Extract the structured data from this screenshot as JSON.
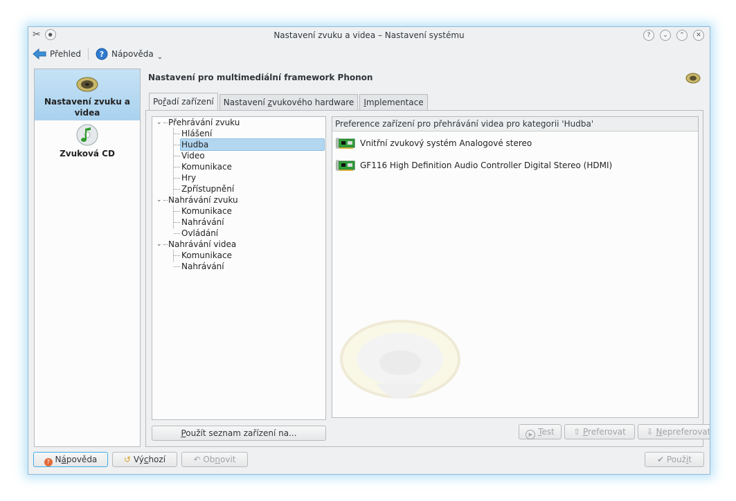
{
  "window": {
    "title": "Nastavení zvuku a videa – Nastavení systému",
    "controls": [
      "?",
      "⌄",
      "⌃",
      "✕"
    ]
  },
  "toolbar": {
    "overview_label": "Přehled",
    "help_label": "Nápověda"
  },
  "sidebar": {
    "items": [
      {
        "label": "Nastavení zvuku a videa",
        "selected": true
      },
      {
        "label": "Zvuková CD",
        "selected": false
      }
    ]
  },
  "panel": {
    "title": "Nastavení pro multimediální framework Phonon",
    "tabs": [
      {
        "pre": "Po",
        "u": "ř",
        "post": "adí zařízení",
        "active": true
      },
      {
        "pre": "Nastavení ",
        "u": "z",
        "post": "vukového hardware",
        "active": false
      },
      {
        "pre": "",
        "u": "I",
        "post": "mplementace",
        "active": false
      }
    ]
  },
  "tree": {
    "groups": [
      {
        "label": "Přehrávání zvuku",
        "children": [
          "Hlášení",
          "Hudba",
          "Video",
          "Komunikace",
          "Hry",
          "Zpřístupnění"
        ]
      },
      {
        "label": "Nahrávání zvuku",
        "children": [
          "Komunikace",
          "Nahrávání",
          "Ovládání"
        ]
      },
      {
        "label": "Nahrávání videa",
        "children": [
          "Komunikace",
          "Nahrávání"
        ]
      }
    ],
    "selected": "Hudba"
  },
  "devices": {
    "header": "Preference zařízení pro přehrávání videa pro kategorii 'Hudba'",
    "items": [
      "Vnitřní zvukový systém Analogové stereo",
      "GF116 High Definition Audio Controller Digital Stereo (HDMI)"
    ]
  },
  "buttons": {
    "apply_list": {
      "pre": "",
      "u": "P",
      "post": "oužít seznam zařízení na..."
    },
    "test": {
      "pre": "",
      "u": "T",
      "post": "est"
    },
    "prefer": {
      "pre": "",
      "u": "P",
      "post": "referovat"
    },
    "unprefer": {
      "pre": "",
      "u": "N",
      "post": "epreferovat"
    },
    "help": {
      "pre": "N",
      "u": "á",
      "post": "pověda"
    },
    "defaults": {
      "pre": "Vý",
      "u": "c",
      "post": "hozí"
    },
    "reset": {
      "pre": "Ob",
      "u": "n",
      "post": "ovit"
    },
    "apply": {
      "pre": "Použ",
      "u": "i",
      "post": "t"
    }
  },
  "colors": {
    "accent": "#3daee9",
    "selection": "#b3d7f1",
    "window_bg": "#eff0f1"
  }
}
